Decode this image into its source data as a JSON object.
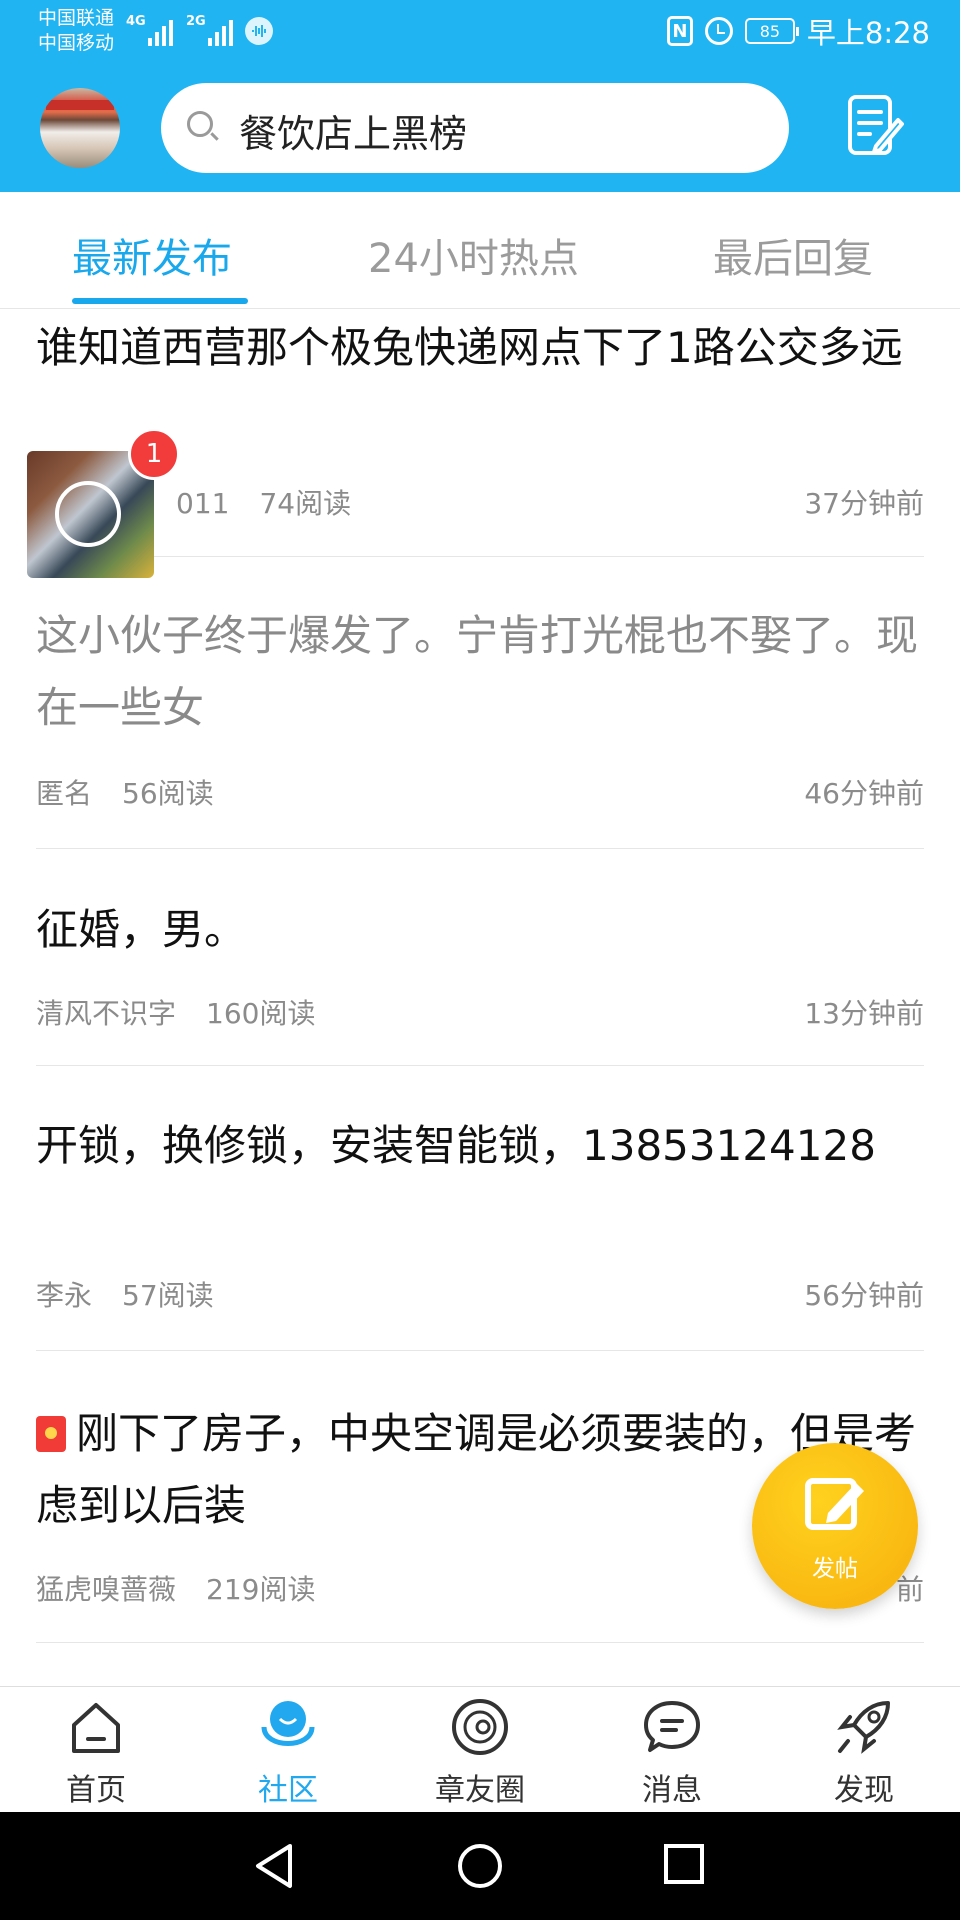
{
  "status_bar": {
    "carrier1": "中国联通",
    "carrier2": "中国移动",
    "sig1_label": "4G",
    "sig2_label": "2G",
    "battery": "85",
    "time": "早上8:28"
  },
  "search": {
    "placeholder": "餐饮店上黑榜"
  },
  "tabs": [
    "最新发布",
    "24小时热点",
    "最后回复"
  ],
  "active_tab": 0,
  "posts": [
    {
      "title": "谁知道西营那个极兔快递网点下了1路公交多远",
      "author": "011",
      "reads": "74阅读",
      "time": "37分钟前"
    },
    {
      "title": "这小伙子终于爆发了。宁肯打光棍也不娶了。现在一些女",
      "author": "匿名",
      "reads": "56阅读",
      "time": "46分钟前"
    },
    {
      "title": "征婚，男。",
      "author": "清风不识字",
      "reads": "160阅读",
      "time": "13分钟前"
    },
    {
      "title": "开锁，换修锁，安装智能锁，13853124128",
      "author": "李永",
      "reads": "57阅读",
      "time": "56分钟前"
    },
    {
      "title": "刚下了房子，中央空调是必须要装的，但是考虑到以后装",
      "author": "猛虎嗅蔷薇",
      "reads": "219阅读",
      "time": "前"
    }
  ],
  "video_badge": "1",
  "fab": {
    "label": "发帖"
  },
  "nav": [
    "首页",
    "社区",
    "章友圈",
    "消息",
    "发现"
  ],
  "active_nav": 1,
  "colors": {
    "brand": "#20b4f2",
    "accent": "#1aa8ec",
    "fab": "#f7ae0c",
    "badge": "#f23b3b"
  }
}
